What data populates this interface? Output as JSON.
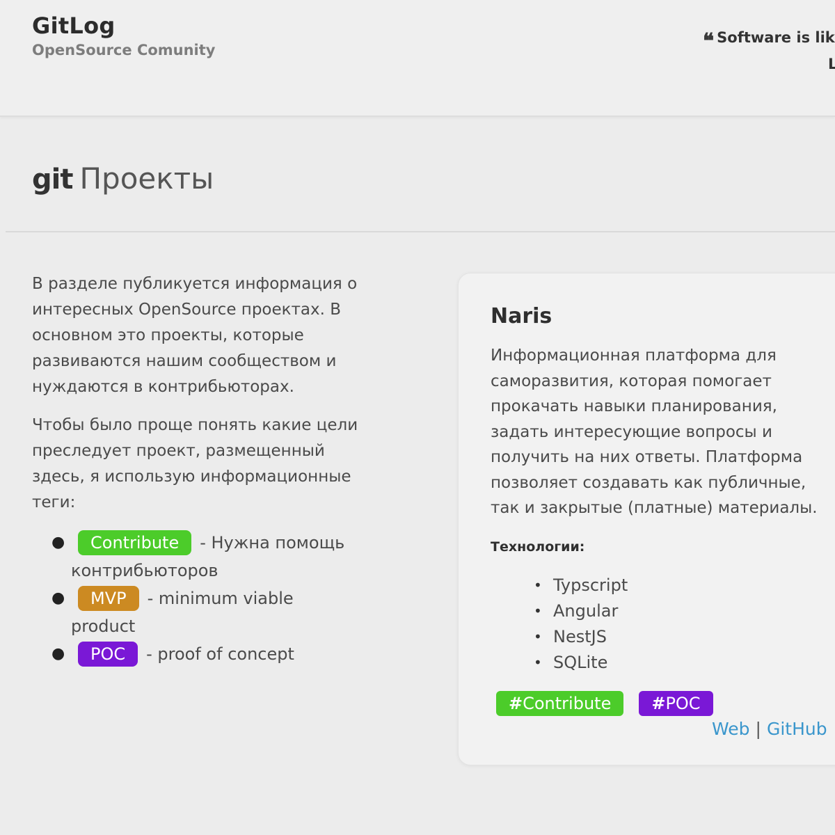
{
  "header": {
    "title": "GitLog",
    "subtitle": "OpenSource Comunity",
    "quote_icon": "quote-icon",
    "quote_text": "Software is like",
    "quote_line2": "L"
  },
  "section": {
    "git_word": "git",
    "heading": "Проекты"
  },
  "intro": {
    "paragraph1": "В разделе публикуется информация о интересных OpenSource проектах. В основном это проекты, которые развиваются нашим сообществом и нуждаются в контрибьюторах.",
    "paragraph2": "Чтобы было проще понять какие цели преследует проект, размещенный здесь, я использую информационные теги:"
  },
  "tags": [
    {
      "label": "Contribute",
      "description": "- Нужна помощь контрибьюторов",
      "color": "#4ccc2a"
    },
    {
      "label": "MVP",
      "description": "- minimum viable product",
      "color": "#cc8a22"
    },
    {
      "label": "POC",
      "description": "- proof of concept",
      "color": "#7a18d6"
    }
  ],
  "project": {
    "name": "Naris",
    "description": "Информационная платформа для саморазвития, которая помогает прокачать навыки планирования, задать интересующие вопросы и получить на них ответы. Платформа позволяет создавать как публичные, так и закрытые (платные) материалы.",
    "tech_label": "Технологии:",
    "technologies": [
      "Typscript",
      "Angular",
      "NestJS",
      "SQLite"
    ],
    "hashtags": [
      {
        "hash": "#",
        "label": "Contribute",
        "color": "#4ccc2a"
      },
      {
        "hash": "#",
        "label": "POC",
        "color": "#7a18d6"
      }
    ],
    "links": {
      "web": "Web",
      "separator": "|",
      "github": "GitHub"
    }
  },
  "colors": {
    "background": "#ececec",
    "link": "#3a96cc",
    "text": "#4a4a4a"
  }
}
